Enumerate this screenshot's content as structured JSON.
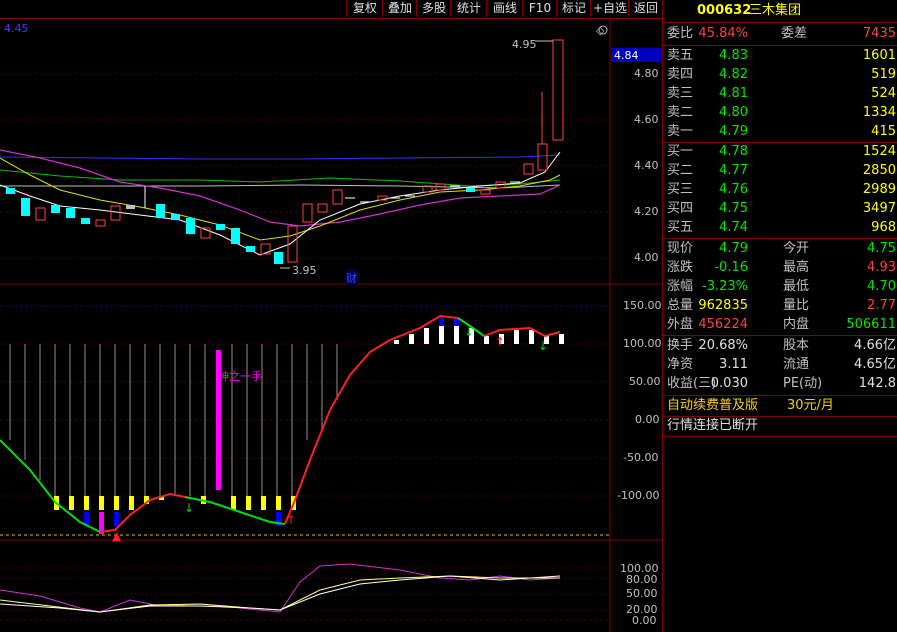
{
  "toolbar": {
    "items": [
      "复权",
      "叠加",
      "多股",
      "统计",
      "画线",
      "F10",
      "标记",
      "+自选",
      "返回"
    ]
  },
  "main_chart": {
    "top_left_value": "4.45",
    "high_label": "4.95",
    "low_label": "3.95",
    "marker_label": "财",
    "current_price_tag": "4.84",
    "y_ticks": [
      "4.80",
      "4.60",
      "4.40",
      "4.20",
      "4.00"
    ]
  },
  "indicator_chart": {
    "y_ticks": [
      "150.00",
      "100.00",
      "50.00",
      "0.00",
      "-50.00",
      "-100.00"
    ],
    "annotation": "神之一手"
  },
  "kdj_chart": {
    "y_ticks": [
      "100.00",
      "80.00",
      "50.00",
      "20.00",
      "0.00"
    ]
  },
  "quote": {
    "code": "000632",
    "name": "三木集团",
    "weibi_label": "委比",
    "weibi_value": "45.84%",
    "weicha_label": "委差",
    "weicha_value": "7435",
    "sell": [
      {
        "label": "卖五",
        "price": "4.83",
        "vol": "1601"
      },
      {
        "label": "卖四",
        "price": "4.82",
        "vol": "519"
      },
      {
        "label": "卖三",
        "price": "4.81",
        "vol": "524"
      },
      {
        "label": "卖二",
        "price": "4.80",
        "vol": "1334"
      },
      {
        "label": "卖一",
        "price": "4.79",
        "vol": "415"
      }
    ],
    "buy": [
      {
        "label": "买一",
        "price": "4.78",
        "vol": "1524"
      },
      {
        "label": "买二",
        "price": "4.77",
        "vol": "2850"
      },
      {
        "label": "买三",
        "price": "4.76",
        "vol": "2989"
      },
      {
        "label": "买四",
        "price": "4.75",
        "vol": "3497"
      },
      {
        "label": "买五",
        "price": "4.74",
        "vol": "968"
      }
    ],
    "stats": [
      {
        "l1": "现价",
        "v1": "4.79",
        "l2": "今开",
        "v2": "4.75"
      },
      {
        "l1": "涨跌",
        "v1": "-0.16",
        "l2": "最高",
        "v2": "4.93"
      },
      {
        "l1": "涨幅",
        "v1": "-3.23%",
        "l2": "最低",
        "v2": "4.70"
      },
      {
        "l1": "总量",
        "v1": "962835",
        "l2": "量比",
        "v2": "2.77"
      },
      {
        "l1": "外盘",
        "v1": "456224",
        "l2": "内盘",
        "v2": "506611"
      }
    ],
    "fund": [
      {
        "l1": "换手",
        "v1": "20.68%",
        "l2": "股本",
        "v2": "4.66亿"
      },
      {
        "l1": "净资",
        "v1": "3.11",
        "l2": "流通",
        "v2": "4.65亿"
      },
      {
        "l1": "收益(三)",
        "v1": "0.030",
        "l2": "PE(动)",
        "v2": "142.8"
      }
    ],
    "promo": "自动续费普及版",
    "promo_price": "30元/月",
    "status": "行情连接已断开"
  }
}
